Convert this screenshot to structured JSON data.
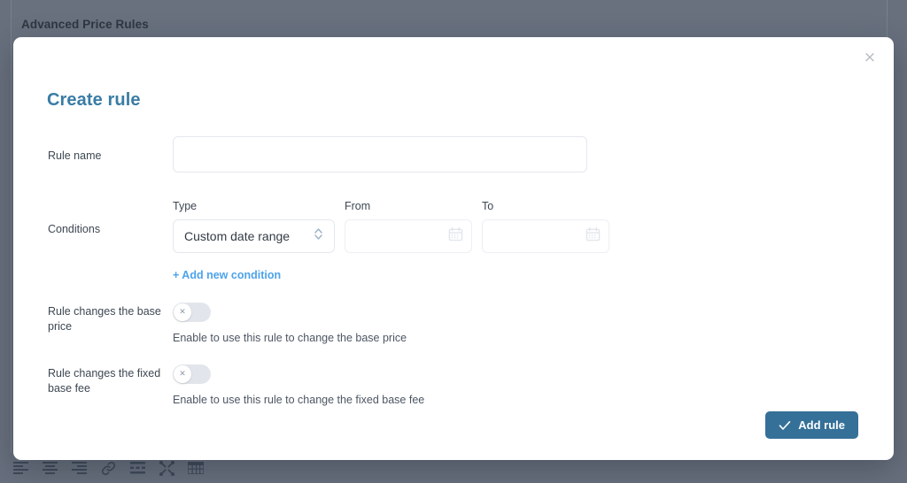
{
  "background": {
    "page_title": "Advanced Price Rules",
    "toolbar": {
      "items": [
        {
          "name": "align-left-icon",
          "label": "Align left"
        },
        {
          "name": "align-center-icon",
          "label": "Align center"
        },
        {
          "name": "align-right-icon",
          "label": "Align right"
        },
        {
          "name": "link-icon",
          "label": "Insert link"
        },
        {
          "name": "horizontal-rule-icon",
          "label": "Horizontal rule"
        },
        {
          "name": "fullscreen-icon",
          "label": "Fullscreen"
        },
        {
          "name": "table-icon",
          "label": "Insert table"
        }
      ]
    }
  },
  "modal": {
    "title": "Create rule",
    "close_label": "×",
    "rule_name": {
      "label": "Rule name",
      "value": "",
      "placeholder": ""
    },
    "conditions": {
      "label": "Conditions",
      "type_label": "Type",
      "type_value": "Custom date range",
      "type_options": [
        "Custom date range"
      ],
      "from_label": "From",
      "from_value": "",
      "from_placeholder": "",
      "to_label": "To",
      "to_value": "",
      "to_placeholder": "",
      "add_condition_label": "+ Add new condition"
    },
    "base_price_toggle": {
      "label": "Rule changes the base price",
      "state": "off",
      "knob_glyph": "✕",
      "helper": "Enable to use this rule to change the base price"
    },
    "fixed_base_fee_toggle": {
      "label": "Rule changes the fixed base fee",
      "state": "off",
      "knob_glyph": "✕",
      "helper": "Enable to use this rule to change the fixed base fee"
    },
    "submit": {
      "label": "Add rule",
      "icon": "check-icon"
    }
  },
  "colors": {
    "accent_title": "#3a7ca5",
    "link": "#4da3ea",
    "button": "#357098",
    "backdrop": "#68707e",
    "toggle_track": "#e2e6ec"
  }
}
